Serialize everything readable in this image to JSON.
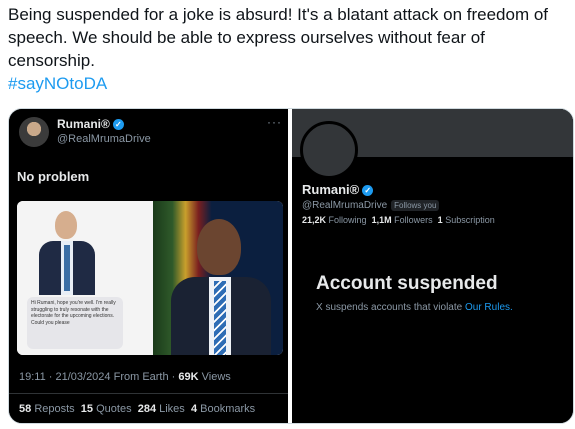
{
  "post": {
    "text": "Being suspended for a joke is absurd! It's a blatant attack on freedom of speech. We should be able to express ourselves without fear of censorship.",
    "hashtag": "#sayNOtoDA"
  },
  "left_screenshot": {
    "name": "Rumani®",
    "handle": "@RealMrumaDrive",
    "more": "···",
    "body": "No problem",
    "sms_text": "Hi Rumani, hope you're well. I'm really struggling to truly resonate with the electorate for the upcoming elections. Could you please",
    "time": "19:11 · 21/03/2024 From Earth ·",
    "views_count": "69K",
    "views_label": "Views",
    "reposts_count": "58",
    "reposts_label": "Reposts",
    "quotes_count": "15",
    "quotes_label": "Quotes",
    "likes_count": "284",
    "likes_label": "Likes",
    "bookmarks_count": "4",
    "bookmarks_label": "Bookmarks"
  },
  "right_screenshot": {
    "name": "Rumani®",
    "handle": "@RealMrumaDrive",
    "follows_badge": "Follows you",
    "following_count": "21,2K",
    "following_label": "Following",
    "followers_count": "1,1M",
    "followers_label": "Followers",
    "subscription_count": "1",
    "subscription_label": "Subscription",
    "suspended_title": "Account suspended",
    "suspended_text": "X suspends accounts that violate",
    "rules_link": "Our Rules."
  },
  "colors": {
    "accent": "#1d9bf0",
    "dark_bg": "#000000",
    "muted": "#8b98a5"
  }
}
